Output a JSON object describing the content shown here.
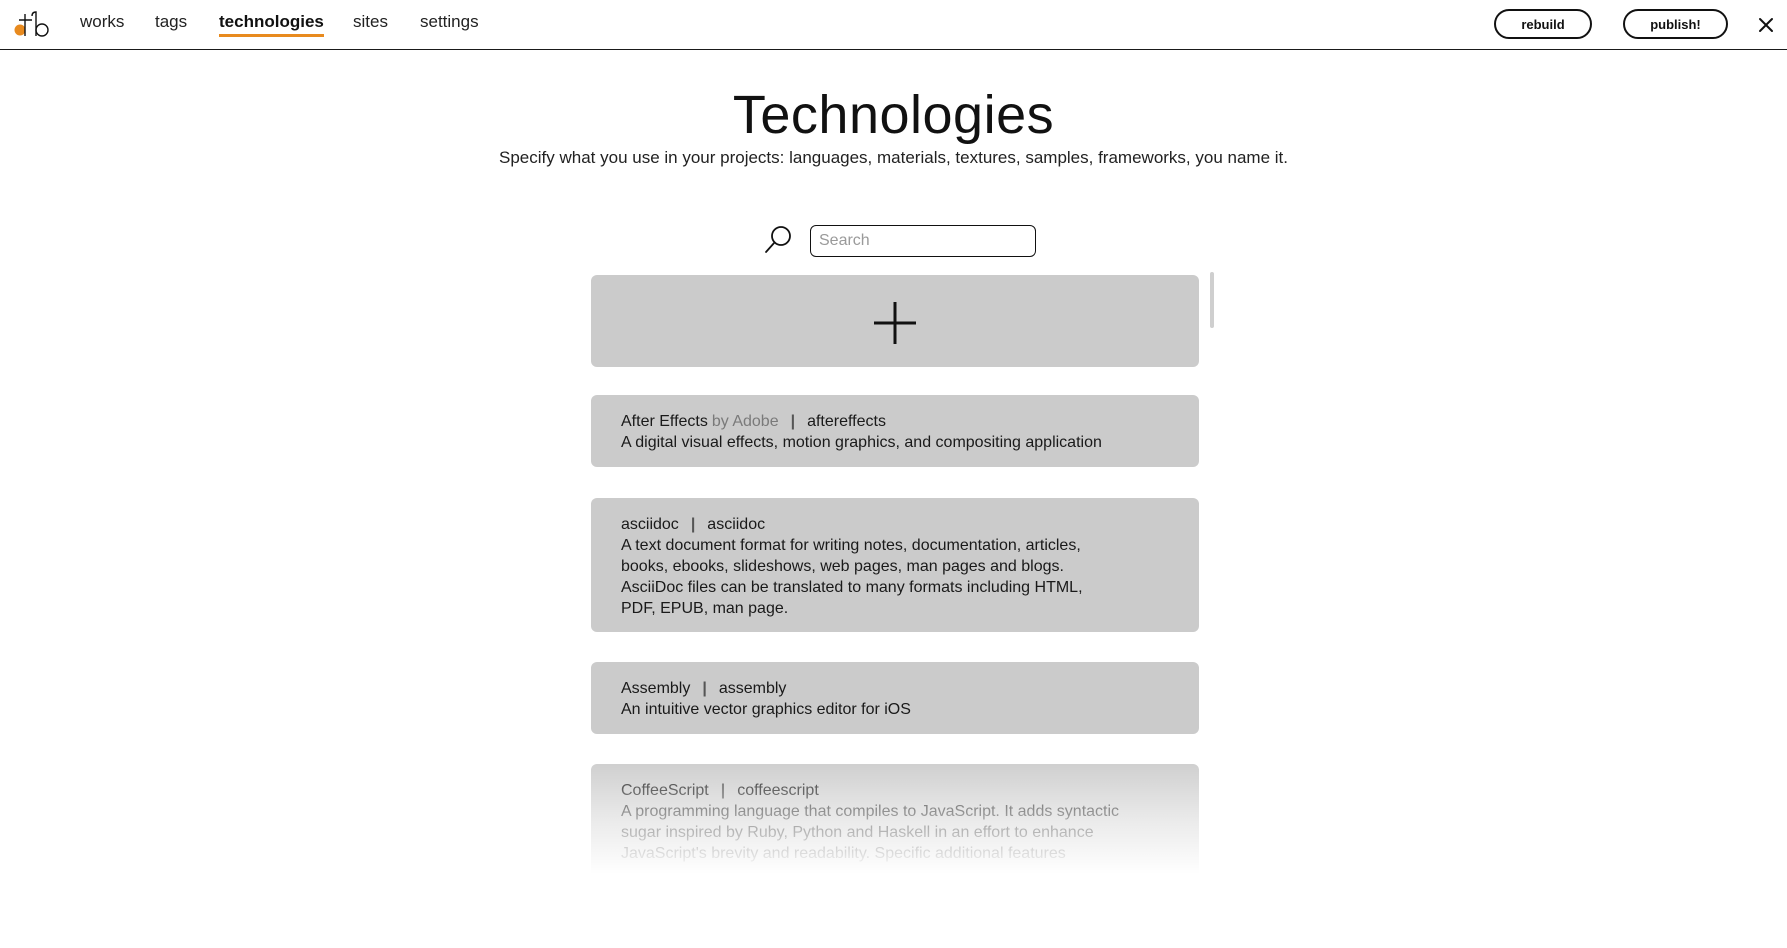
{
  "nav": {
    "links": [
      {
        "label": "works"
      },
      {
        "label": "tags"
      },
      {
        "label": "technologies"
      },
      {
        "label": "sites"
      },
      {
        "label": "settings"
      }
    ],
    "active": "technologies",
    "rebuild_label": "rebuild",
    "publish_label": "publish!",
    "accent_color": "#e88a1e"
  },
  "header": {
    "title": "Technologies",
    "subtitle": "Specify what you use in your projects: languages, materials, textures, samples, frameworks, you name it."
  },
  "search": {
    "placeholder": "Search",
    "value": ""
  },
  "technologies": [
    {
      "name": "After Effects",
      "author": "by Adobe",
      "slug": "aftereffects",
      "description": "A digital visual effects, motion graphics, and compositing application"
    },
    {
      "name": "asciidoc",
      "slug": "asciidoc",
      "description": "A text document format for writing notes, documentation, articles, books, ebooks, slideshows, web pages, man pages and blogs. AsciiDoc files can be translated to many formats including HTML, PDF, EPUB, man page."
    },
    {
      "name": "Assembly",
      "slug": "assembly",
      "description": "An intuitive vector graphics editor for iOS"
    },
    {
      "name": "CoffeeScript",
      "slug": "coffeescript",
      "description": "A programming language that compiles to JavaScript. It adds syntactic sugar inspired by Ruby, Python and Haskell in an effort to enhance JavaScript's brevity and readability. Specific additional features"
    }
  ]
}
